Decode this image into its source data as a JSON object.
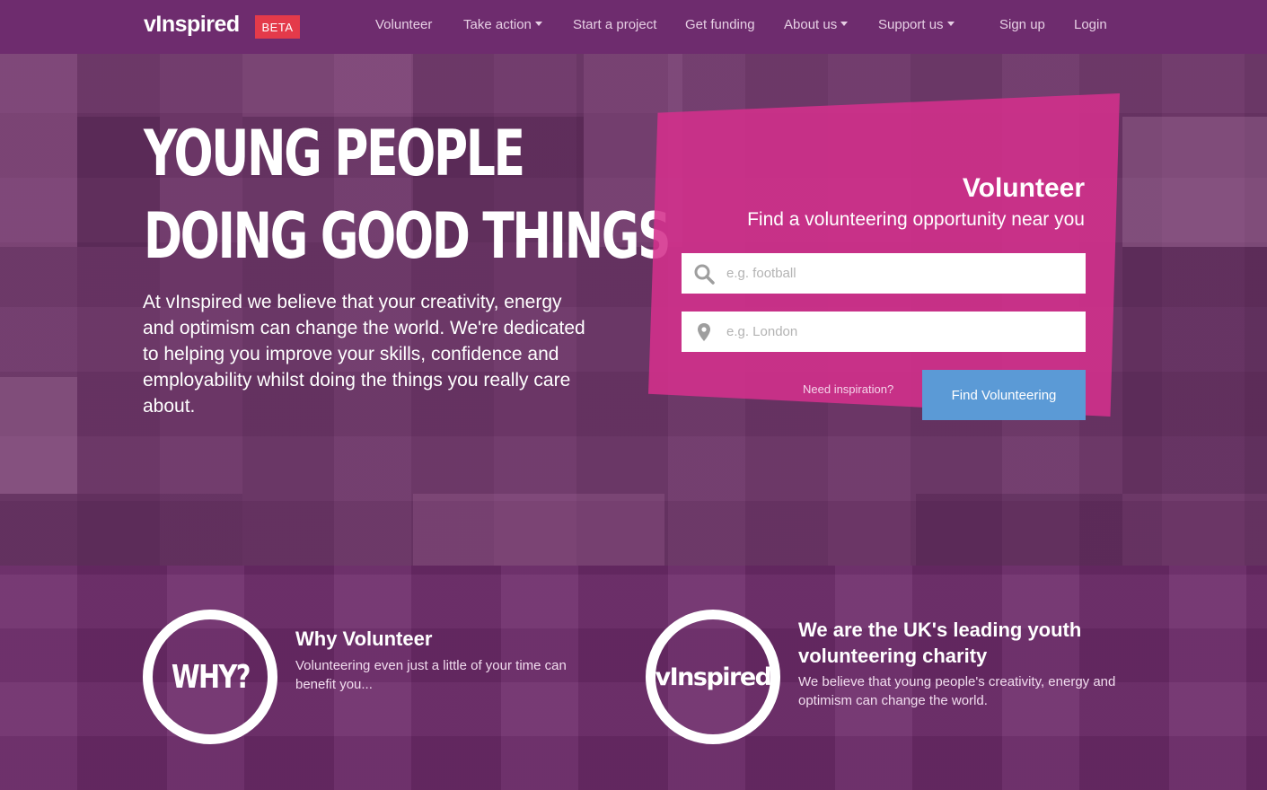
{
  "nav": {
    "logo": "vInspired",
    "beta": "BETA",
    "items": [
      {
        "label": "Volunteer"
      },
      {
        "label": "Take action"
      },
      {
        "label": "Start a project"
      },
      {
        "label": "Get funding"
      },
      {
        "label": "About us"
      },
      {
        "label": "Support us"
      }
    ],
    "signup": "Sign up",
    "login": "Login"
  },
  "hero": {
    "title_line1": "YOUNG PEOPLE",
    "title_line2": "DOING GOOD THINGS",
    "description": "At vInspired we believe that your creativity, energy and optimism can change the world. We're dedicated to helping you improve your skills, confidence and employability whilst doing the things you really care about."
  },
  "search": {
    "title": "Volunteer",
    "subtitle": "Find a volunteering opportunity near you",
    "keyword_placeholder": "e.g. football",
    "location_placeholder": "e.g. London",
    "need_inspiration": "Need inspiration?",
    "button": "Find Volunteering"
  },
  "bottom": {
    "why_circle": "WHY?",
    "why_title": "Why Volunteer",
    "why_text": "Volunteering even just a little of your time can benefit you...",
    "brand_circle": "vInspired",
    "brand_title": "We are the UK's leading youth volunteering charity",
    "brand_text": "We believe that young people's creativity, energy and optimism can change the world."
  },
  "colors": {
    "nav_bg": "#6e2c6e",
    "beta_bg": "#e43a4a",
    "card_bg": "#d4308c",
    "button_bg": "#5b9ad6",
    "bottom_bg": "#6d2b6a"
  }
}
